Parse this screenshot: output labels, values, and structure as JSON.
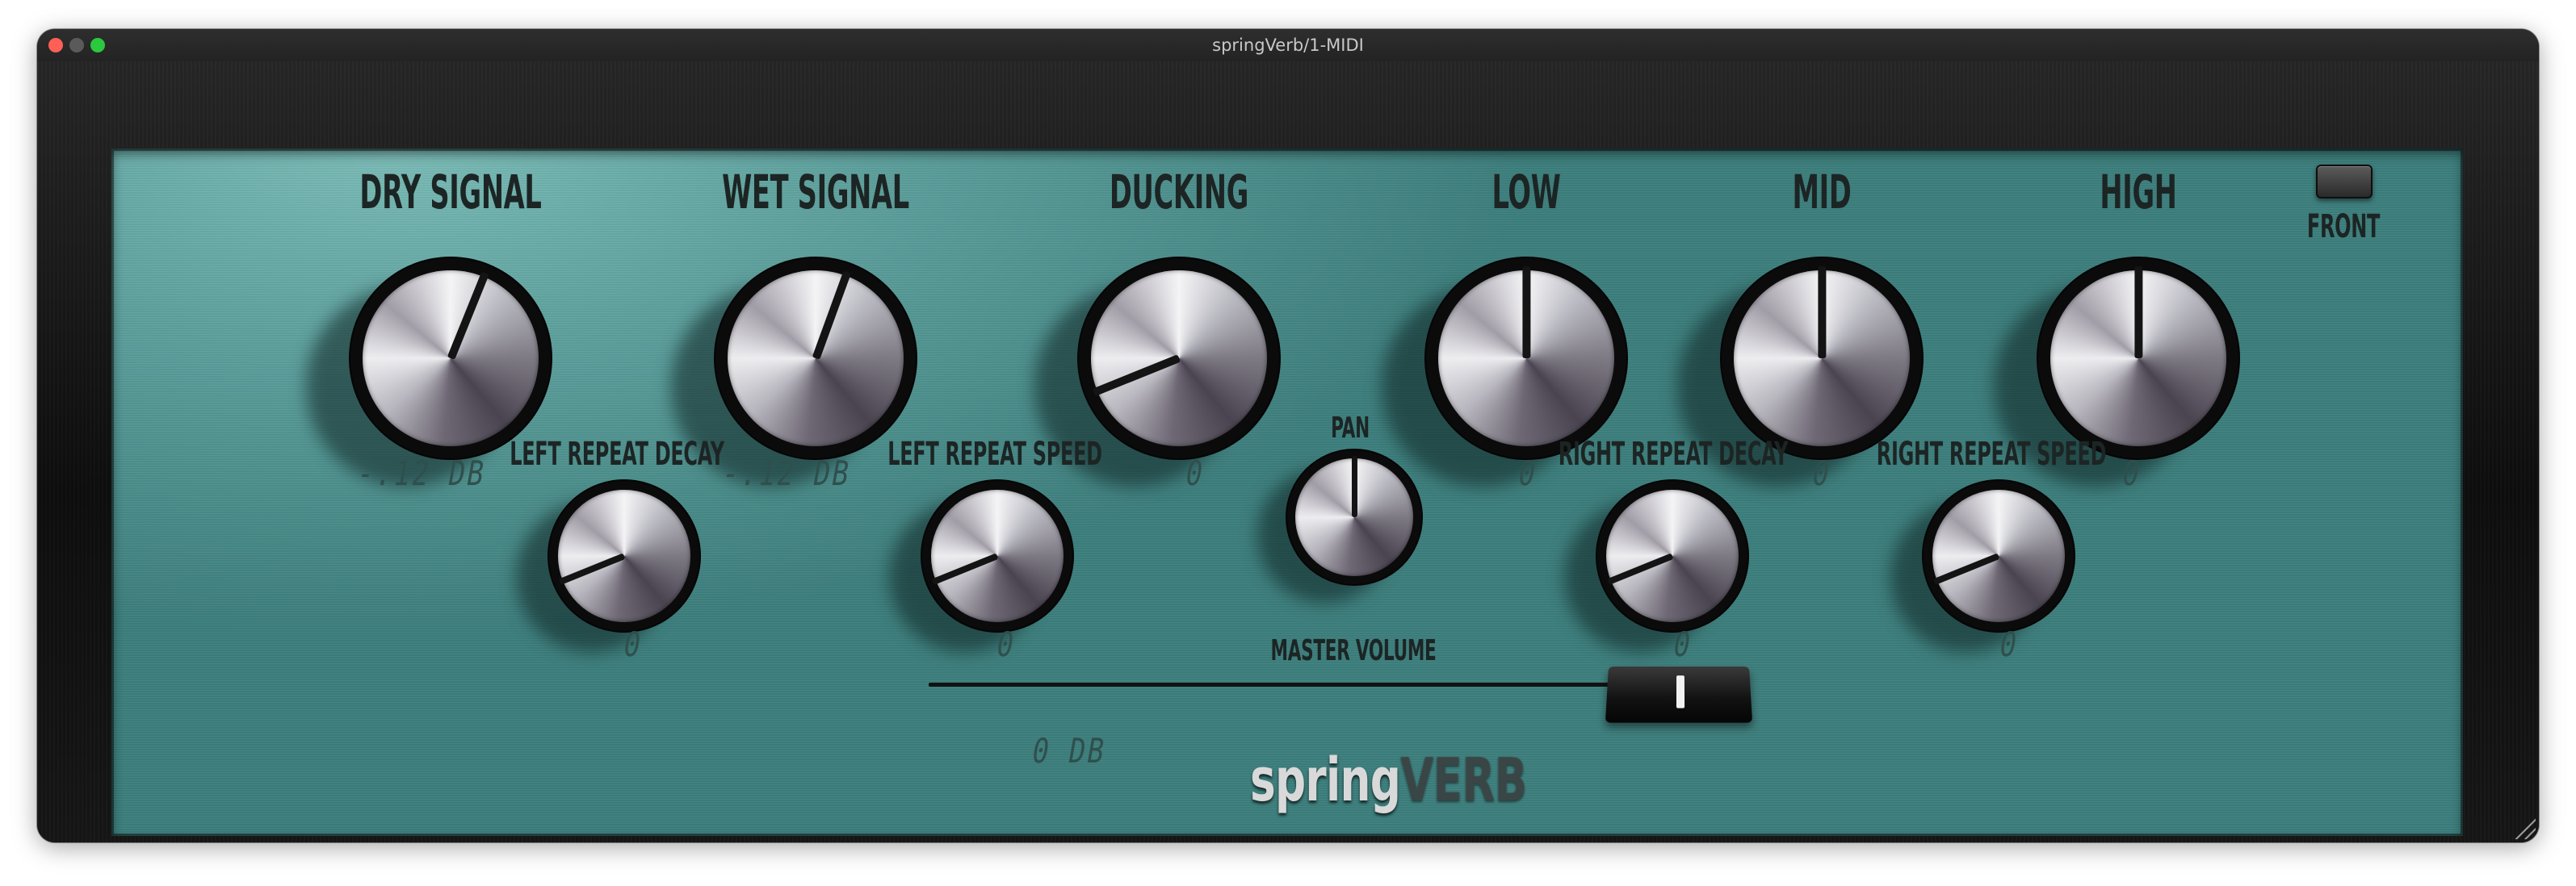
{
  "window": {
    "title": "springVerb/1-MIDI"
  },
  "plugin": {
    "brand_part1": "spring",
    "brand_part2": "VERB",
    "front_label": "FRONT",
    "knobs": [
      {
        "id": "dry-signal",
        "label": "DRY SIGNAL",
        "value": "-.12 DB",
        "angle": 22
      },
      {
        "id": "wet-signal",
        "label": "WET SIGNAL",
        "value": "-.12 DB",
        "angle": 20
      },
      {
        "id": "ducking",
        "label": "DUCKING",
        "value": "0",
        "angle": -112
      },
      {
        "id": "low",
        "label": "LOW",
        "value": "0",
        "angle": 0
      },
      {
        "id": "mid",
        "label": "MID",
        "value": "0",
        "angle": 0
      },
      {
        "id": "high",
        "label": "HIGH",
        "value": "0",
        "angle": 0
      },
      {
        "id": "left-repeat-decay",
        "label": "LEFT  REPEAT DECAY",
        "value": "0",
        "angle": -112
      },
      {
        "id": "left-repeat-speed",
        "label": "LEFT REPEAT SPEED",
        "value": "0",
        "angle": -112
      },
      {
        "id": "pan",
        "label": "PAN",
        "value": "",
        "angle": 0
      },
      {
        "id": "right-repeat-decay",
        "label": "RIGHT REPEAT DECAY",
        "value": "0",
        "angle": -112
      },
      {
        "id": "right-repeat-speed",
        "label": "RIGHT REPEAT SPEED",
        "value": "0",
        "angle": -112
      }
    ],
    "master_volume": {
      "label": "MASTER VOLUME",
      "value": "0 DB",
      "level": 1.0
    }
  }
}
